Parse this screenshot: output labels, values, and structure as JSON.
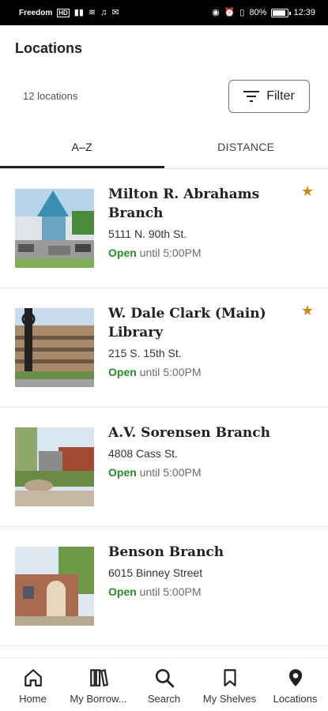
{
  "status_bar": {
    "carrier": "Freedom",
    "carrier_badge": "HD",
    "battery": "80%",
    "battery_level": 0.8,
    "time": "12:39"
  },
  "header": {
    "title": "Locations",
    "count": "12 locations",
    "filter_label": "Filter"
  },
  "tabs": [
    {
      "label": "A–Z",
      "active": true
    },
    {
      "label": "DISTANCE",
      "active": false
    }
  ],
  "locations": [
    {
      "name": "Milton R. Abrahams Branch",
      "address": "5111 N. 90th St.",
      "open_label": "Open",
      "hours": " until 5:00PM",
      "favorite": true,
      "star": "★"
    },
    {
      "name": "W. Dale Clark (Main) Library",
      "address": "215 S. 15th St.",
      "open_label": "Open",
      "hours": " until 5:00PM",
      "favorite": true,
      "star": "★"
    },
    {
      "name": "A.V. Sorensen Branch",
      "address": "4808 Cass St.",
      "open_label": "Open",
      "hours": " until 5:00PM",
      "favorite": false
    },
    {
      "name": "Benson Branch",
      "address": "6015 Binney Street",
      "open_label": "Open",
      "hours": " until 5:00PM",
      "favorite": false
    }
  ],
  "bottom_nav": [
    {
      "label": "Home",
      "icon": "home-icon"
    },
    {
      "label": "My Borrow...",
      "icon": "books-icon"
    },
    {
      "label": "Search",
      "icon": "search-icon"
    },
    {
      "label": "My Shelves",
      "icon": "bookmark-icon"
    },
    {
      "label": "Locations",
      "icon": "location-pin-icon"
    }
  ],
  "colors": {
    "open_green": "#2a8a2a",
    "star_gold": "#c98a15"
  }
}
